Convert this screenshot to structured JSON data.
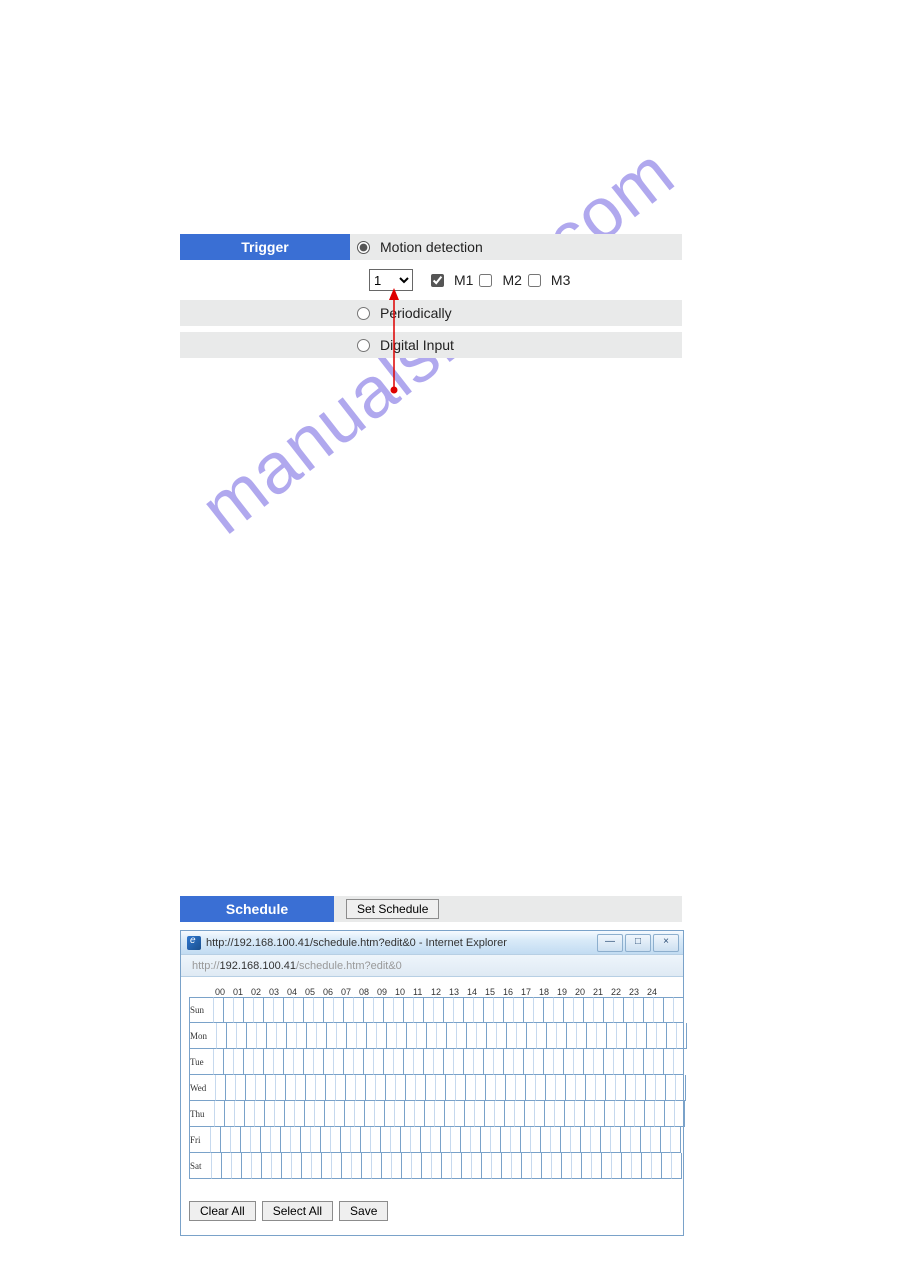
{
  "watermark": "manualshive.com",
  "trigger": {
    "header": "Trigger",
    "motion_label": "Motion detection",
    "select_value": "1",
    "m1_label": "M1",
    "m2_label": "M2",
    "m3_label": "M3",
    "periodically_label": "Periodically",
    "digital_input_label": "Digital Input"
  },
  "schedule": {
    "header": "Schedule",
    "set_btn": "Set Schedule",
    "ie_title": "http://192.168.100.41/schedule.htm?edit&0 - Internet Explorer",
    "ie_addr_prefix": "http://",
    "ie_addr_host": "192.168.100.41",
    "ie_addr_path": "/schedule.htm?edit&0",
    "hours": [
      "00",
      "01",
      "02",
      "03",
      "04",
      "05",
      "06",
      "07",
      "08",
      "09",
      "10",
      "11",
      "12",
      "13",
      "14",
      "15",
      "16",
      "17",
      "18",
      "19",
      "20",
      "21",
      "22",
      "23",
      "24"
    ],
    "days": [
      "Sun",
      "Mon",
      "Tue",
      "Wed",
      "Thu",
      "Fri",
      "Sat"
    ],
    "clear_all": "Clear All",
    "select_all": "Select All",
    "save": "Save",
    "win_min": "—",
    "win_max": "□",
    "win_close": "×"
  }
}
